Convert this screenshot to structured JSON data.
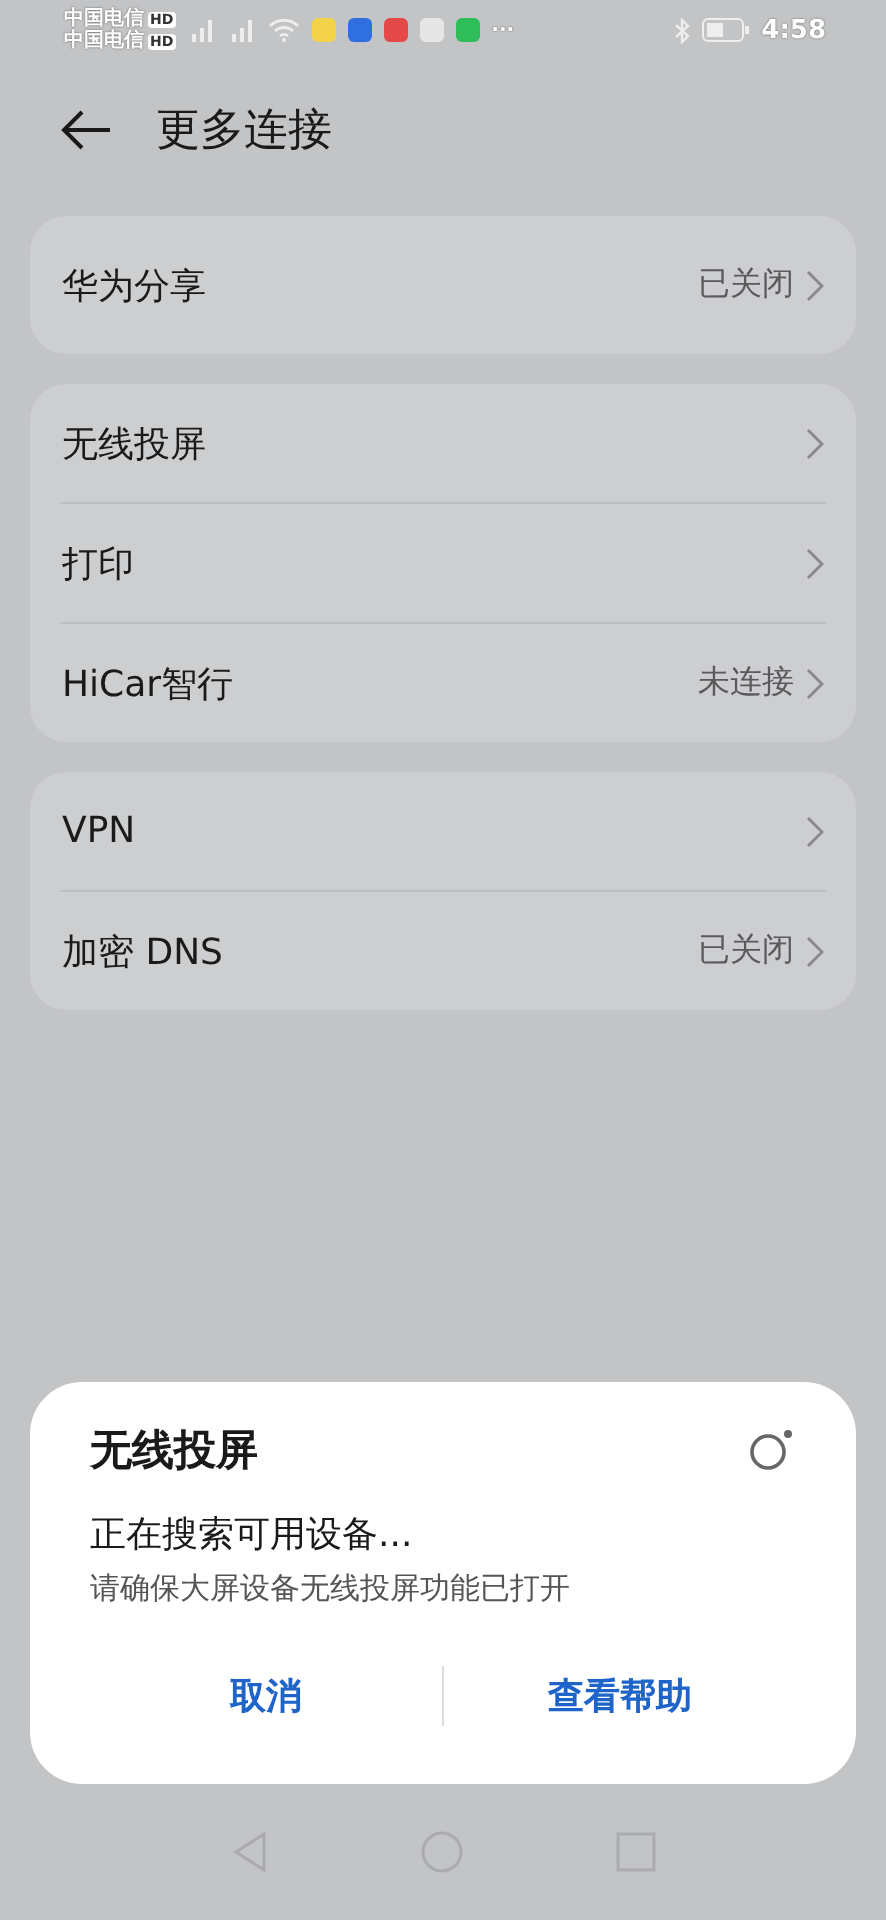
{
  "status_bar": {
    "carriers": [
      {
        "name": "中国电信",
        "badge": "HD"
      },
      {
        "name": "中国电信",
        "badge": "HD"
      }
    ],
    "more": "···",
    "time": "4:58"
  },
  "header": {
    "title": "更多连接"
  },
  "groups": [
    [
      {
        "label": "华为分享",
        "value": "已关闭"
      }
    ],
    [
      {
        "label": "无线投屏"
      },
      {
        "label": "打印"
      },
      {
        "label": "HiCar智行",
        "value": "未连接"
      }
    ],
    [
      {
        "label": "VPN"
      },
      {
        "label": "加密 DNS",
        "value": "已关闭"
      }
    ]
  ],
  "dialog": {
    "title": "无线投屏",
    "status": "正在搜索可用设备...",
    "hint": "请确保大屏设备无线投屏功能已打开",
    "buttons": [
      "取消",
      "查看帮助"
    ]
  }
}
